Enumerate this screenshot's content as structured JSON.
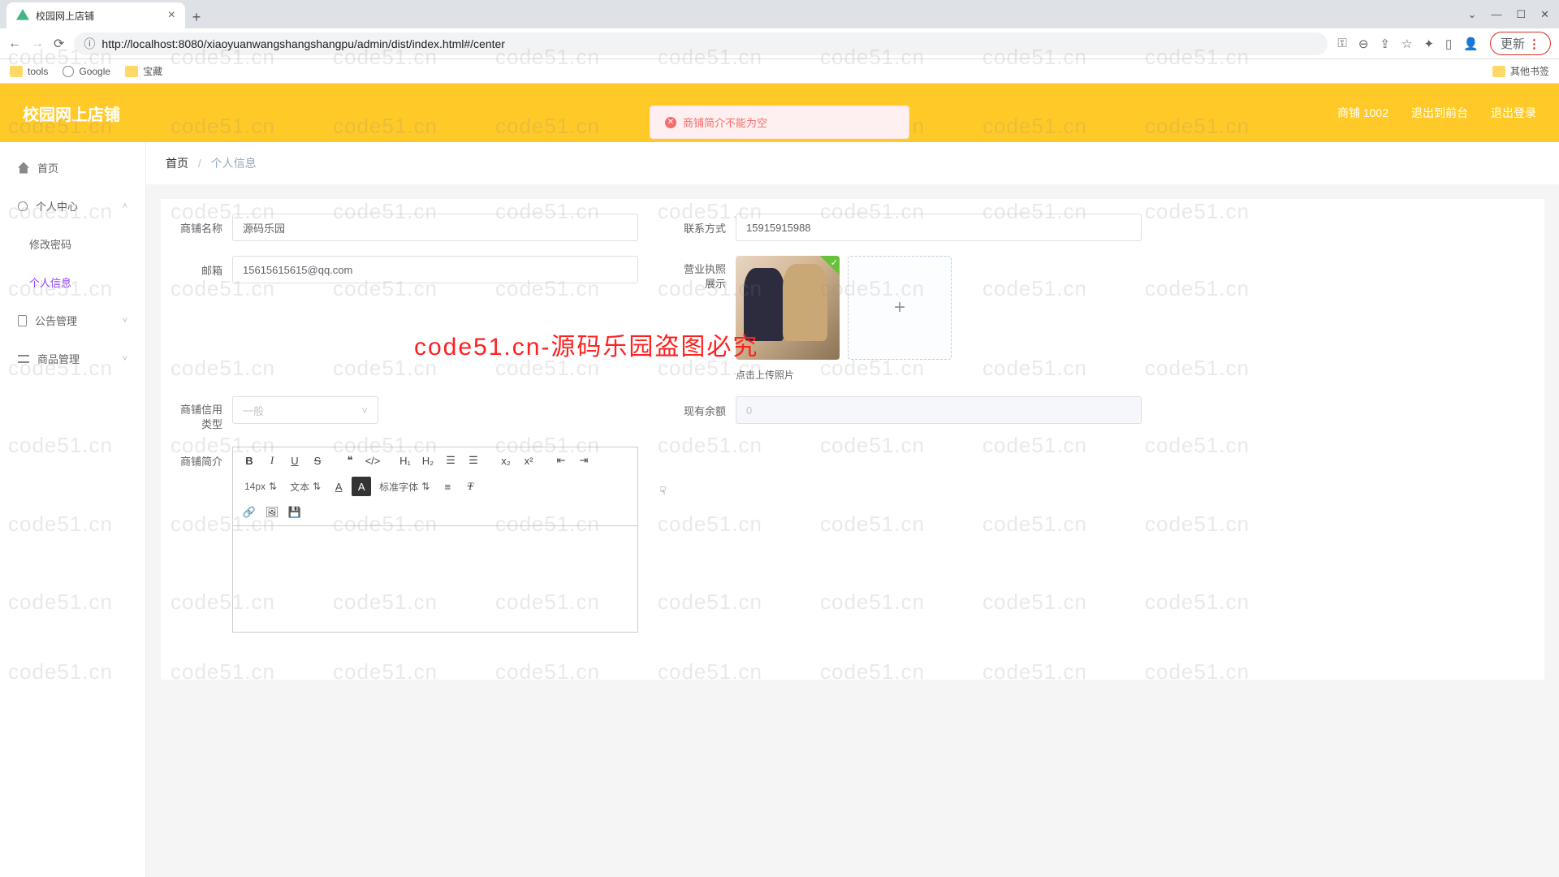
{
  "browser": {
    "tab_title": "校园网上店铺",
    "url_display": "http://localhost:8080/xiaoyuanwangshangshangpu/admin/dist/index.html#/center",
    "update_label": "更新",
    "bookmarks": {
      "tools": "tools",
      "google": "Google",
      "treasure": "宝藏",
      "other": "其他书签"
    }
  },
  "header": {
    "app_title": "校园网上店铺",
    "shop_label": "商铺 1002",
    "logout_front": "退出到前台",
    "logout": "退出登录"
  },
  "notification": {
    "message": "商铺简介不能为空"
  },
  "sidebar": {
    "home": "首页",
    "personal": "个人中心",
    "change_pwd": "修改密码",
    "personal_info": "个人信息",
    "announce": "公告管理",
    "product": "商品管理"
  },
  "breadcrumb": {
    "home": "首页",
    "current": "个人信息"
  },
  "form": {
    "shop_name_label": "商铺名称",
    "shop_name_value": "源码乐园",
    "contact_label": "联系方式",
    "contact_value": "15915915988",
    "email_label": "邮箱",
    "email_value": "15615615615@qq.com",
    "license_label": "营业执照展示",
    "upload_tip": "点击上传照片",
    "credit_label": "商铺信用类型",
    "credit_value": "一般",
    "balance_label": "现有余额",
    "balance_value": "0",
    "intro_label": "商铺简介"
  },
  "editor": {
    "font_size": "14px",
    "format": "文本",
    "font_family": "标准字体"
  },
  "watermark": {
    "text": "code51.cn",
    "red_text": "code51.cn-源码乐园盗图必究"
  }
}
